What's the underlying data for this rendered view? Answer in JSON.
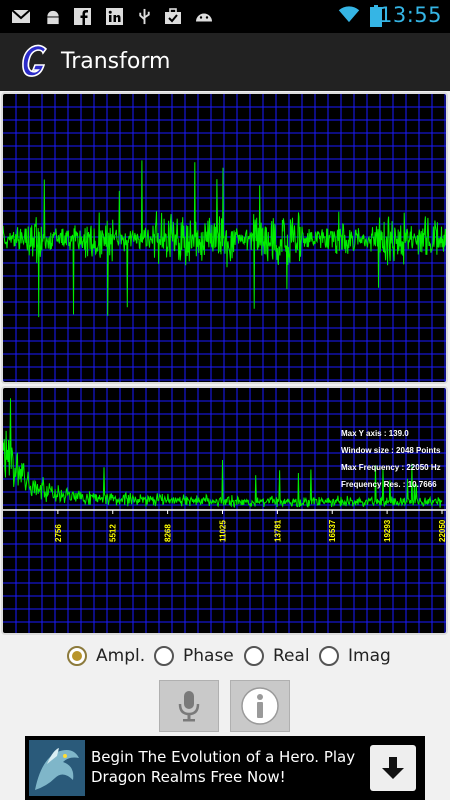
{
  "status_bar": {
    "time": "13:55",
    "left_icons": [
      "gmail-icon",
      "android-debug-icon",
      "facebook-icon",
      "linkedin-icon",
      "usb-icon",
      "briefcase-icon",
      "android-icon"
    ],
    "right_icons": [
      "wifi-icon",
      "battery-icon"
    ]
  },
  "action_bar": {
    "title": "Transform"
  },
  "info_overlay": {
    "max_y_axis": "Max Y axis    : 139.0",
    "window_size": "Window size    : 2048 Points",
    "max_frequency": "Max Frequency  : 22050 Hz",
    "frequency_res": "Frequency Res.  : 10.7666"
  },
  "chart_data": [
    {
      "type": "line",
      "title": "",
      "description_series": "time-domain waveform",
      "grid": true,
      "colors": {
        "line": "#00ee00",
        "grid": "#1a1aff",
        "background": "#000000"
      }
    },
    {
      "type": "line",
      "title": "",
      "grid": true,
      "x_tick_labels": [
        "2756",
        "5512",
        "8268",
        "11025",
        "13781",
        "16537",
        "19293",
        "22050"
      ],
      "xlim": [
        0,
        22050
      ],
      "ylim": [
        0,
        139.0
      ],
      "colors": {
        "line": "#00ee00",
        "grid": "#1a1aff",
        "axis_labels": "#ffff00",
        "info_text": "#ffffff"
      }
    }
  ],
  "radio_group": {
    "options": [
      {
        "label": "Ampl.",
        "checked": true
      },
      {
        "label": "Phase",
        "checked": false
      },
      {
        "label": "Real",
        "checked": false
      },
      {
        "label": "Imag",
        "checked": false
      }
    ]
  },
  "buttons": {
    "mic": "microphone-icon",
    "info": "info-icon"
  },
  "ad": {
    "text": "Begin The Evolution of a Hero. Play Dragon Realms Free Now!",
    "button_icon": "download-arrow-icon"
  }
}
